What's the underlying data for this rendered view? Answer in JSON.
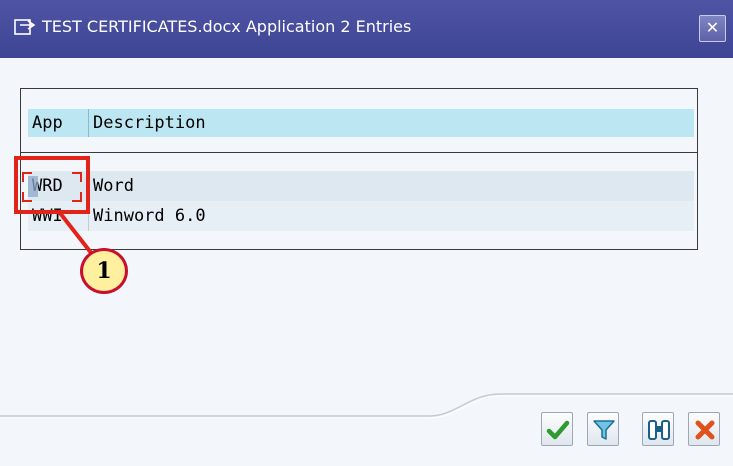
{
  "window": {
    "title": "TEST CERTIFICATES.docx Application 2 Entries",
    "close_icon": "close-icon"
  },
  "table": {
    "columns": [
      "App",
      "Description"
    ],
    "rows": [
      {
        "app": "WRD",
        "description": "Word"
      },
      {
        "app": "WWI",
        "description": "Winword 6.0"
      }
    ]
  },
  "callout": {
    "number": "1"
  },
  "toolbar": {
    "icons": [
      "checkmark-icon",
      "filter-icon",
      "binoculars-icon",
      "cancel-icon"
    ]
  },
  "colors": {
    "titlebar": "#4047a0",
    "header_highlight": "#bde6f3",
    "callout_red": "#e2231a",
    "badge_fill": "#fff0a0",
    "ok_green": "#2f9a2f",
    "cancel_orange": "#e0521b"
  }
}
